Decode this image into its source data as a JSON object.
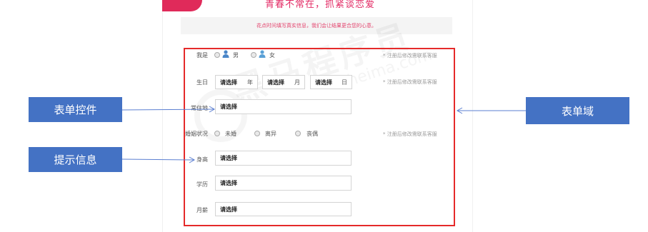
{
  "page": {
    "headline": "青春不常在，抓紧谈恋爱",
    "notice": "花点时间填写真实信息，我们会让结果更合您的心意。",
    "watermark_text": "黑马程序员",
    "watermark_sub": "itheima.com"
  },
  "form": {
    "gender": {
      "label": "我是",
      "options": [
        "男",
        "女"
      ],
      "hint": "* 注册后修改需联系客服"
    },
    "birthday": {
      "label": "生日",
      "year_placeholder": "请选择",
      "year_unit": "年",
      "month_placeholder": "请选择",
      "month_unit": "月",
      "day_placeholder": "请选择",
      "day_unit": "日",
      "hint": "* 注册后修改需联系客服"
    },
    "residence": {
      "label": "常住地",
      "value": "请选择"
    },
    "marital": {
      "label": "婚姻状况",
      "options": [
        "未婚",
        "离异",
        "丧偶"
      ],
      "hint": "* 注册后修改需联系客服"
    },
    "height": {
      "label": "身高",
      "value": "请选择"
    },
    "education": {
      "label": "学历",
      "value": "请选择"
    },
    "salary": {
      "label": "月薪",
      "value": "请选择"
    }
  },
  "annotations": {
    "form_control": "表单控件",
    "hint_info": "提示信息",
    "form_domain": "表单域"
  },
  "colors": {
    "accent_pink": "#e32c66",
    "form_border": "#e52a2a",
    "callout_blue": "#4472c4",
    "arrow_blue": "#5b7fd1"
  },
  "icons": [
    "male-person-icon",
    "female-person-icon"
  ]
}
